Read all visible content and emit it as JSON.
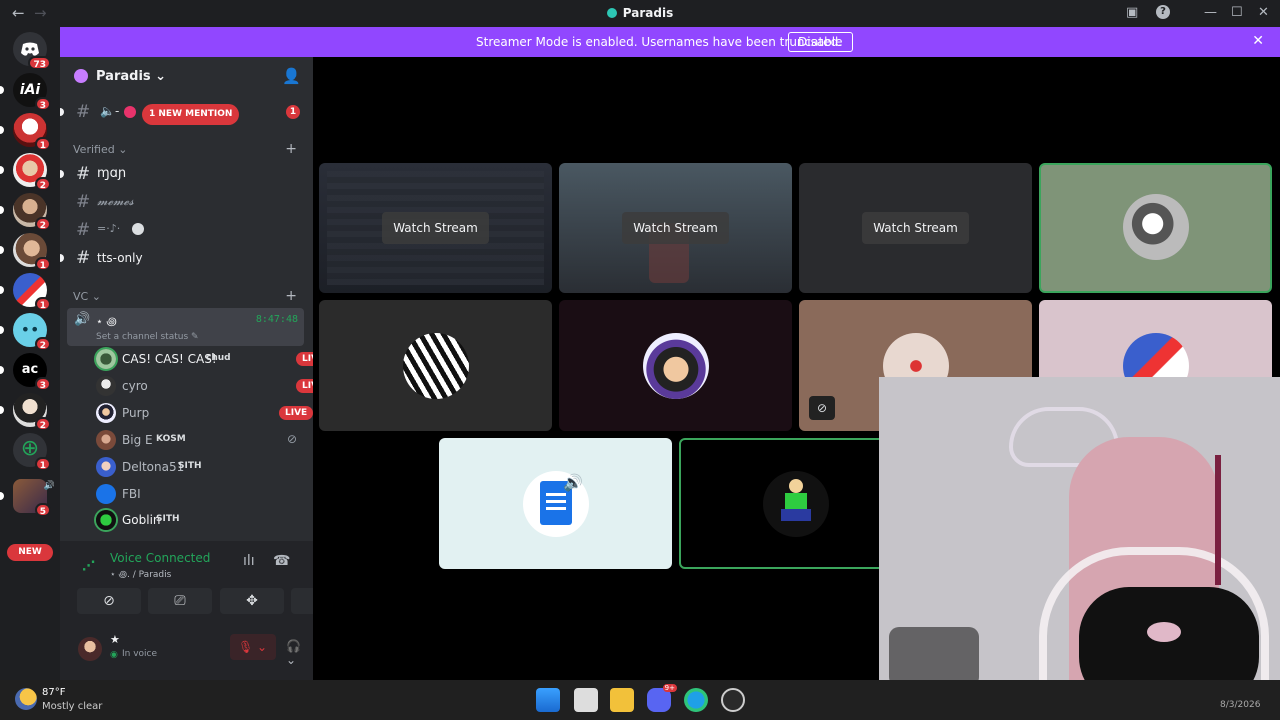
{
  "window": {
    "title": "Paradis",
    "back": "←",
    "forward": "→",
    "controls": [
      "—",
      "☐",
      "✕"
    ]
  },
  "banner": {
    "text": "Streamer Mode is enabled. Usernames have been truncated.",
    "button": "Disable",
    "close": "✕"
  },
  "guilds": {
    "home_badge": "73",
    "badges": [
      "3",
      "1",
      "2",
      "2",
      "1",
      "1",
      "2",
      "3",
      "2",
      "1",
      "5"
    ],
    "new_label": "NEW"
  },
  "server": {
    "name": "Paradis",
    "chevron": "⌄"
  },
  "channels": {
    "top_channel_badge": "1",
    "mention_pill": "1 NEW MENTION",
    "category_verified": "Verified",
    "verified": [
      "ɱɑɲ",
      "𝓶𝓮𝓶𝓮𝓼",
      "=⁠·♪·",
      "tts-only"
    ],
    "category_vc": "VC",
    "voice_channel": {
      "name": "⋆ ꩜",
      "timer": "8:47:48",
      "status": "Set a channel status"
    }
  },
  "members": [
    {
      "name": "CAS! CAS! CAS!",
      "tag": "chud",
      "live": "LIVE"
    },
    {
      "name": "cyro",
      "tag": "",
      "live": "LIVE"
    },
    {
      "name": "Purp",
      "tag": "",
      "live": "LIVE"
    },
    {
      "name": "Big E",
      "tag": "KOSM",
      "live": ""
    },
    {
      "name": "Deltona51",
      "tag": "SITH",
      "live": ""
    },
    {
      "name": "FBI",
      "tag": "",
      "live": ""
    },
    {
      "name": "Goblin",
      "tag": "SITH",
      "live": ""
    }
  ],
  "voice": {
    "status": "Voice Connected",
    "channel": "⋆ ꩜. / Paradis"
  },
  "user": {
    "name": "★",
    "status": "In voice"
  },
  "stage": {
    "watch_label": "Watch Stream"
  },
  "taskbar": {
    "temp": "87°F",
    "weather": "Mostly clear",
    "date": "8/3/2026",
    "discord_badge": "9+"
  },
  "colors": {
    "accent": "#9147ff",
    "live": "#da373c",
    "voice_green": "#23a55a",
    "speaking": "#3ba55c"
  }
}
